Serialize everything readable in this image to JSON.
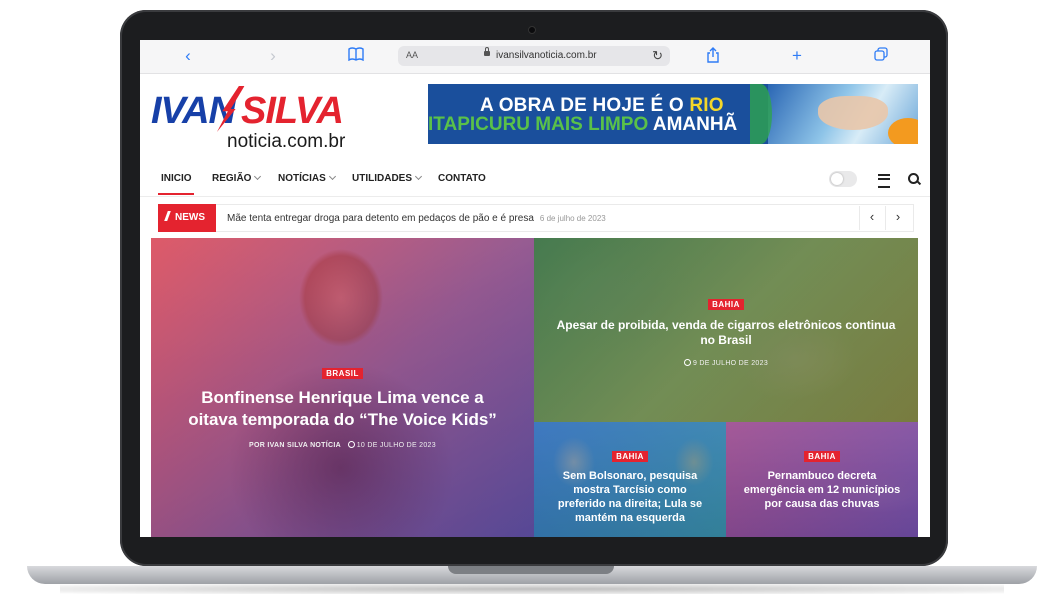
{
  "browser": {
    "aa_label": "AA",
    "url": "ivansilvanoticia.com.br"
  },
  "logo": {
    "part1": "IVAN",
    "part2": "SILVA",
    "sub": "noticia.com.br"
  },
  "banner": {
    "line1_a": "A OBRA DE HOJE É O",
    "line1_b": "RIO",
    "line2_a": "ITAPICURU MAIS LIMPO",
    "line2_b": "AMANHÃ"
  },
  "nav": {
    "items": [
      {
        "label": "INICIO",
        "active": true
      },
      {
        "label": "REGIÃO",
        "dropdown": true
      },
      {
        "label": "NOTÍCIAS",
        "dropdown": true
      },
      {
        "label": "UTILIDADES",
        "dropdown": true
      },
      {
        "label": "CONTATO"
      }
    ]
  },
  "ticker": {
    "badge": "NEWS",
    "headline": "Mãe tenta entregar droga para detento em pedaços de pão e é presa",
    "date": "6 de julho de 2023",
    "prev": "‹",
    "next": "›"
  },
  "articles": [
    {
      "category": "BRASIL",
      "title": "Bonfinense Henrique Lima vence a oitava temporada do “The Voice Kids”",
      "author": "POR IVAN SILVA NOTÍCIA",
      "date": "10 DE JULHO DE 2023"
    },
    {
      "category": "BAHIA",
      "title": "Apesar de proibida, venda de cigarros eletrônicos continua no Brasil",
      "date": "9 DE JULHO DE 2023"
    },
    {
      "category": "BAHIA",
      "title": "Sem Bolsonaro, pesquisa mostra Tarcísio como preferido na direita; Lula se mantém na esquerda"
    },
    {
      "category": "BAHIA",
      "title": "Pernambuco decreta emergência em 12 municípios por causa das chuvas"
    }
  ],
  "colors": {
    "accent": "#e4232f",
    "brand_blue": "#1740a8",
    "browser_blue": "#2f7cf6"
  },
  "icons": [
    "back-icon",
    "forward-icon",
    "book-icon",
    "lock-icon",
    "reload-icon",
    "share-icon",
    "plus-icon",
    "tabs-icon",
    "dark-mode-toggle",
    "menu-icon",
    "search-icon",
    "bolt-icon",
    "clock-icon"
  ]
}
